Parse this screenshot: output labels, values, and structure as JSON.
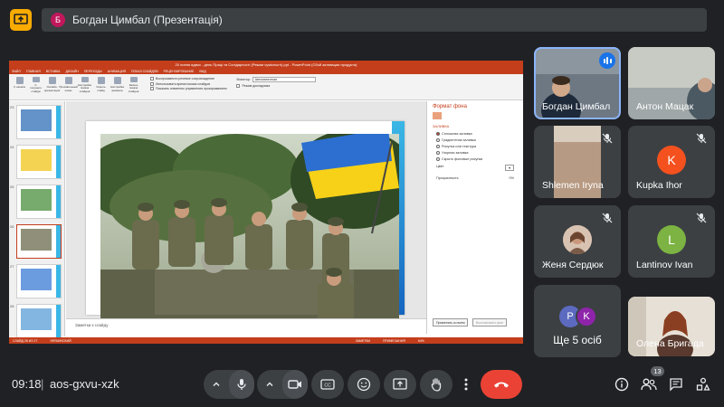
{
  "meeting": {
    "presenter_initial": "Б",
    "presenter_label": "Богдан Цимбал (Презентація)",
    "time": "09:18",
    "separator": "|",
    "code": "aos-gxvu-xzk",
    "participant_count": "13"
  },
  "presentation": {
    "window_title": "20 липня вдвох - день Праці та Солідарності (Режим сумісності).ppt - PowerPoint (Сбой активации продукта)",
    "tabs": [
      "ФАЙЛ",
      "ГЛАВНАЯ",
      "ВСТАВКА",
      "ДИЗАЙН",
      "ПЕРЕХОДЫ",
      "АНИМАЦИЯ",
      "ПОКАЗ СЛАЙДОВ",
      "РЕЦЕНЗИРОВАНИЕ",
      "ВИД"
    ],
    "ribbon_buttons": [
      "С начала",
      "С текущего слайда",
      "Онлайн-презентация",
      "Произвольный показ",
      "Настройка показа слайдов",
      "Скрыть слайд",
      "Настройка времени",
      "Запись показа слайдов"
    ],
    "ribbon_checks": [
      "Воспроизвести речевое сопровождение",
      "Использовать время показа слайдов",
      "Показать элементы управления проигрыванием"
    ],
    "monitor_label": "Монитор:",
    "monitor_value": "Автоматически",
    "presenter_view_check": "Режим докладчика",
    "slide_numbers": [
      "23",
      "24",
      "25",
      "26",
      "27",
      "28"
    ],
    "selected_slide": "26",
    "notes_placeholder": "Заметки к слайду",
    "format_pane": {
      "title": "Формат фона",
      "section": "ЗАЛИВКА",
      "options": [
        "Сплошная заливка",
        "Градиентная заливка",
        "Рисунок или текстура",
        "Узорная заливка",
        "Скрыть фоновые рисунки"
      ],
      "color_label": "Цвет",
      "transparency_label": "Прозрачность",
      "transparency_value": "0%",
      "apply_all": "Применить ко всем",
      "reset": "Восстановить фон"
    },
    "status": [
      "СЛАЙД 26 ИЗ 27",
      "УКРАИНСКИЙ",
      "ЗАМЕТКИ",
      "ПРИМЕЧАНИЯ",
      "64%"
    ]
  },
  "participants": [
    {
      "name": "Богдан Цимбал",
      "type": "video",
      "speaking": true
    },
    {
      "name": "Антон Мацак",
      "type": "video",
      "speaking": false
    },
    {
      "name": "Shlemen Iryna",
      "type": "video",
      "muted": true
    },
    {
      "name": "Kupka Ihor",
      "type": "avatar",
      "initial": "K",
      "color": "#f4511e",
      "muted": true
    },
    {
      "name": "Женя Сердюк",
      "type": "photo",
      "muted": true
    },
    {
      "name": "Lantinov Ivan",
      "type": "avatar",
      "initial": "L",
      "color": "#7cb342",
      "muted": true
    },
    {
      "name": "Олена Бригада",
      "type": "video",
      "muted": false
    }
  ],
  "more_tile": {
    "text": "Ще 5 осіб",
    "initials": [
      "P",
      "K"
    ],
    "colors": [
      "#5c6bc0",
      "#8e24aa"
    ]
  },
  "colors": {
    "background": "#202124",
    "tile": "#3c4043",
    "end_call": "#ea4335",
    "powerpoint": "#c43e1c",
    "accent": "#8ab4f8"
  },
  "icons": [
    "present-icon",
    "mic-icon",
    "camera-icon",
    "captions-icon",
    "emoji-icon",
    "share-screen-icon",
    "raise-hand-icon",
    "more-icon",
    "end-call-icon",
    "info-icon",
    "people-icon",
    "chat-icon",
    "activities-icon"
  ]
}
